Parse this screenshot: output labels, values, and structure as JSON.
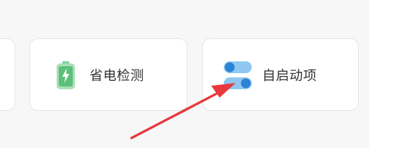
{
  "cards": {
    "power_saving": {
      "label": "省电检测",
      "icon": "battery-charging-icon",
      "icon_color": "#5cc07a"
    },
    "autostart": {
      "label": "自启动项",
      "icon": "toggle-switch-icon",
      "icon_color": "#2b83d6"
    }
  },
  "annotation": {
    "arrow_color": "#e8383d"
  }
}
